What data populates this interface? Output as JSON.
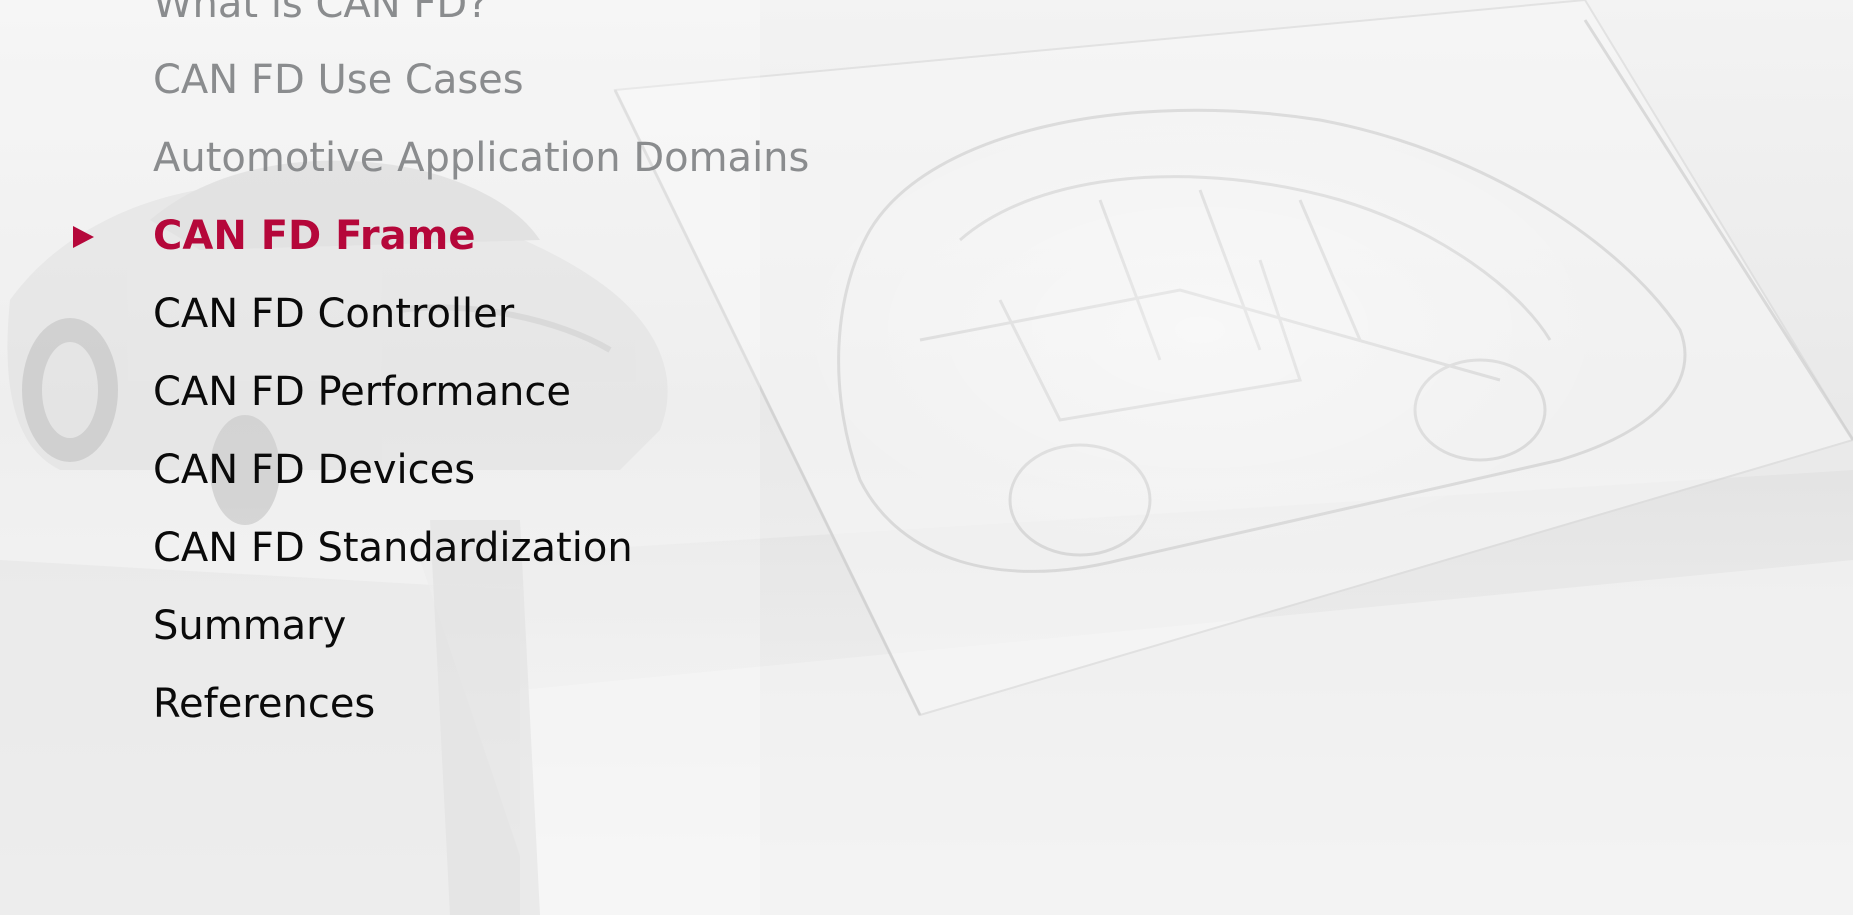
{
  "agenda": {
    "items": [
      {
        "label": "What is CAN FD?",
        "state": "past"
      },
      {
        "label": "CAN FD Use Cases",
        "state": "past"
      },
      {
        "label": "Automotive Application Domains",
        "state": "past"
      },
      {
        "label": "CAN FD Frame",
        "state": "current"
      },
      {
        "label": "CAN FD Controller",
        "state": "upcoming"
      },
      {
        "label": "CAN FD Performance",
        "state": "upcoming"
      },
      {
        "label": "CAN FD Devices",
        "state": "upcoming"
      },
      {
        "label": "CAN FD Standardization",
        "state": "upcoming"
      },
      {
        "label": "Summary",
        "state": "upcoming"
      },
      {
        "label": "References",
        "state": "upcoming"
      }
    ],
    "current_marker_icon": "triangle-right-icon"
  },
  "colors": {
    "accent": "#b5073a",
    "past_text": "#8a8c8e",
    "upcoming_text": "#0a0a0a"
  }
}
